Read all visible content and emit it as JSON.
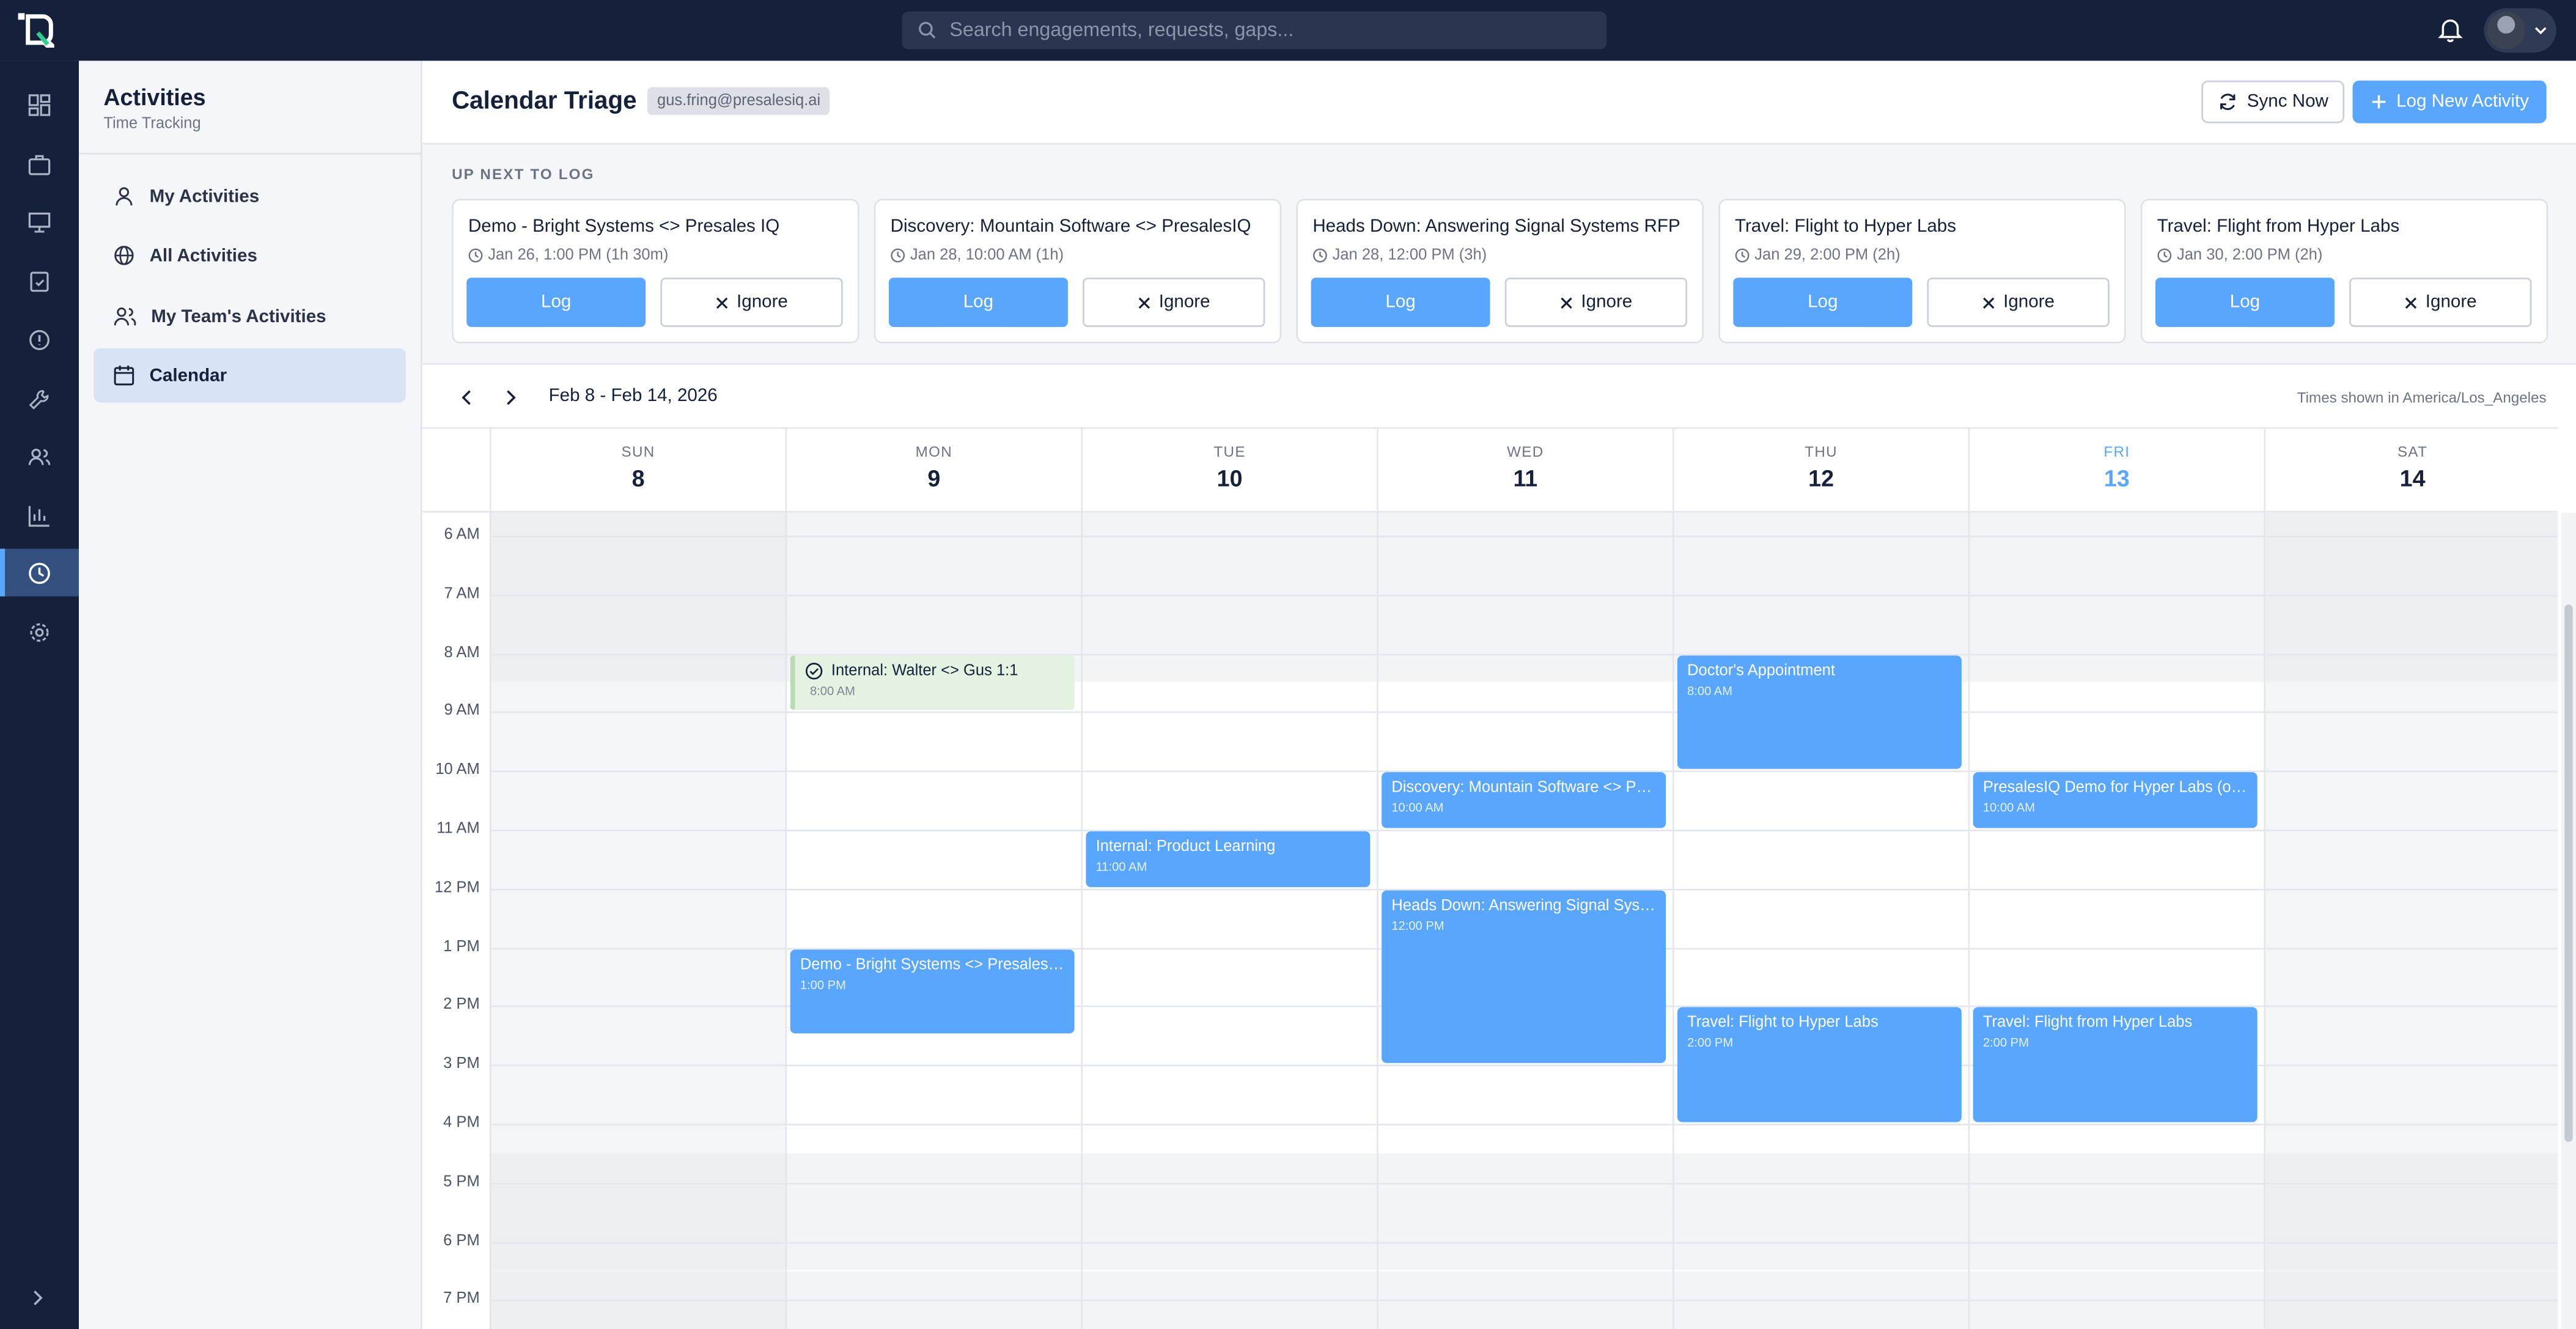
{
  "topbar": {
    "search_placeholder": "Search engagements, requests, gaps..."
  },
  "rail": {
    "items": [
      "dashboard-icon",
      "briefcase-icon",
      "presentation-icon",
      "clipboard-check-icon",
      "alert-circle-icon",
      "wrench-icon",
      "users-icon",
      "bar-chart-icon",
      "clock-icon",
      "gear-icon"
    ],
    "active": "clock-icon"
  },
  "sidebar": {
    "title": "Activities",
    "subtitle": "Time Tracking",
    "items": [
      {
        "label": "My Activities",
        "icon": "user-icon"
      },
      {
        "label": "All Activities",
        "icon": "globe-icon"
      },
      {
        "label": "My Team's Activities",
        "icon": "team-icon"
      },
      {
        "label": "Calendar",
        "icon": "calendar-icon",
        "active": true
      }
    ]
  },
  "header": {
    "title": "Calendar Triage",
    "email": "gus.fring@presalesiq.ai",
    "sync_label": "Sync Now",
    "new_label": "Log New Activity"
  },
  "upnext": {
    "label": "UP NEXT TO LOG",
    "log_label": "Log",
    "ignore_label": "Ignore",
    "cards": [
      {
        "title": "Demo - Bright Systems <> Presales IQ",
        "meta": "Jan 26, 1:00 PM (1h 30m)"
      },
      {
        "title": "Discovery: Mountain Software <> PresalesIQ",
        "meta": "Jan 28, 10:00 AM (1h)"
      },
      {
        "title": "Heads Down: Answering Signal Systems RFP",
        "meta": "Jan 28, 12:00 PM (3h)"
      },
      {
        "title": "Travel: Flight to Hyper Labs",
        "meta": "Jan 29, 2:00 PM (2h)"
      },
      {
        "title": "Travel: Flight from Hyper Labs",
        "meta": "Jan 30, 2:00 PM (2h)"
      }
    ]
  },
  "calendar": {
    "range": "Feb 8 - Feb 14, 2026",
    "timezone": "Times shown in America/Los_Angeles",
    "days": [
      {
        "name": "SUN",
        "num": "8"
      },
      {
        "name": "MON",
        "num": "9"
      },
      {
        "name": "TUE",
        "num": "10"
      },
      {
        "name": "WED",
        "num": "11"
      },
      {
        "name": "THU",
        "num": "12"
      },
      {
        "name": "FRI",
        "num": "13",
        "today": true
      },
      {
        "name": "SAT",
        "num": "14"
      }
    ],
    "hours": [
      "6 AM",
      "7 AM",
      "8 AM",
      "9 AM",
      "10 AM",
      "11 AM",
      "12 PM",
      "1 PM",
      "2 PM",
      "3 PM",
      "4 PM",
      "5 PM",
      "6 PM",
      "7 PM"
    ],
    "events": [
      {
        "title": "Internal: Walter <> Gus 1:1",
        "time": "8:00 AM",
        "day": 1,
        "start": 8,
        "duration": 1,
        "logged": true
      },
      {
        "title": "Demo - Bright Systems <> Presales IQ",
        "time": "1:00 PM",
        "day": 1,
        "start": 13,
        "duration": 1.5
      },
      {
        "title": "Internal: Product Learning",
        "time": "11:00 AM",
        "day": 2,
        "start": 11,
        "duration": 1
      },
      {
        "title": "Discovery: Mountain Software <> PresalesIQ",
        "time": "10:00 AM",
        "day": 3,
        "start": 10,
        "duration": 1
      },
      {
        "title": "Heads Down: Answering Signal Systems RFP",
        "time": "12:00 PM",
        "day": 3,
        "start": 12,
        "duration": 3
      },
      {
        "title": "Doctor's Appointment",
        "time": "8:00 AM",
        "day": 4,
        "start": 8,
        "duration": 2
      },
      {
        "title": "Travel: Flight to Hyper Labs",
        "time": "2:00 PM",
        "day": 4,
        "start": 14,
        "duration": 2
      },
      {
        "title": "PresalesIQ Demo for Hyper Labs (onsite)",
        "time": "10:00 AM",
        "day": 5,
        "start": 10,
        "duration": 1
      },
      {
        "title": "Travel: Flight from Hyper Labs",
        "time": "2:00 PM",
        "day": 5,
        "start": 14,
        "duration": 2
      }
    ]
  },
  "colors": {
    "navy": "#15203b",
    "accent": "#58a6ff",
    "logged_bg": "#e4f2e2"
  }
}
